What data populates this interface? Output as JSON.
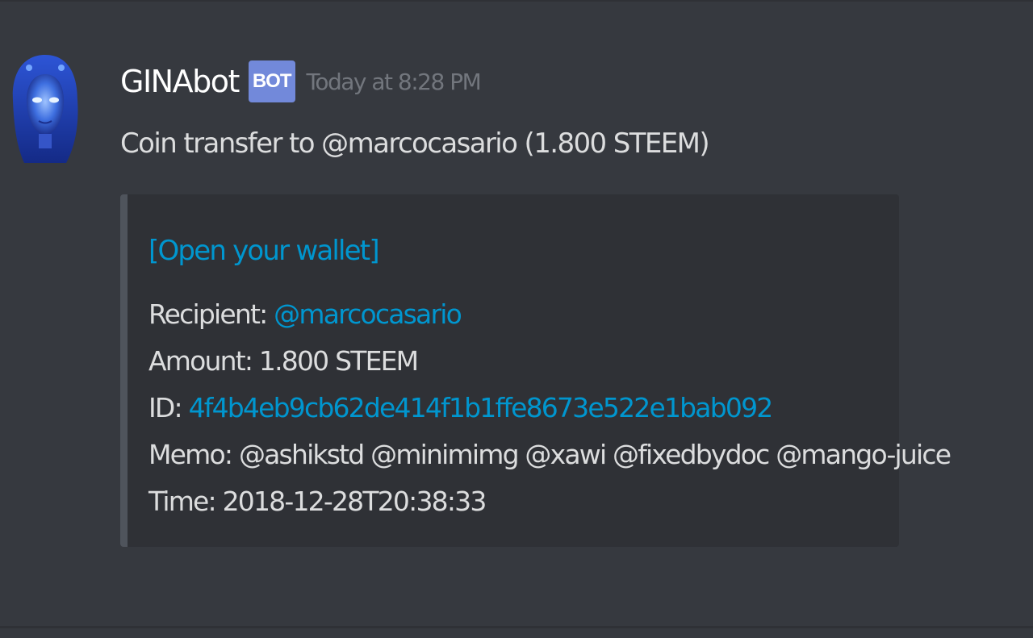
{
  "message": {
    "author": {
      "username": "GINAbot",
      "bot_tag": "BOT",
      "avatar_icon": "blue-robot-avatar"
    },
    "timestamp": "Today at 8:28 PM",
    "content": "Coin transfer to @marcocasario (1.800 STEEM)",
    "embed": {
      "title_link": "[Open your wallet]",
      "fields": {
        "recipient_label": "Recipient:",
        "recipient_value": "@marcocasario",
        "amount_label": "Amount:",
        "amount_value": "1.800 STEEM",
        "id_label": "ID:",
        "id_value": "4f4b4eb9cb62de414f1b1ffe8673e522e1bab092",
        "memo_label": "Memo:",
        "memo_value": "@ashikstd @minimimg @xawi @fixedbydoc @mango-juice",
        "time_label": "Time:",
        "time_value": "2018-12-28T20:38:33"
      }
    }
  },
  "colors": {
    "background": "#36393f",
    "embed_background": "#2f3136",
    "embed_border": "#4f545c",
    "link": "#0096cf",
    "text": "#dcddde",
    "muted": "#72767d",
    "bot_tag": "#7289da"
  }
}
